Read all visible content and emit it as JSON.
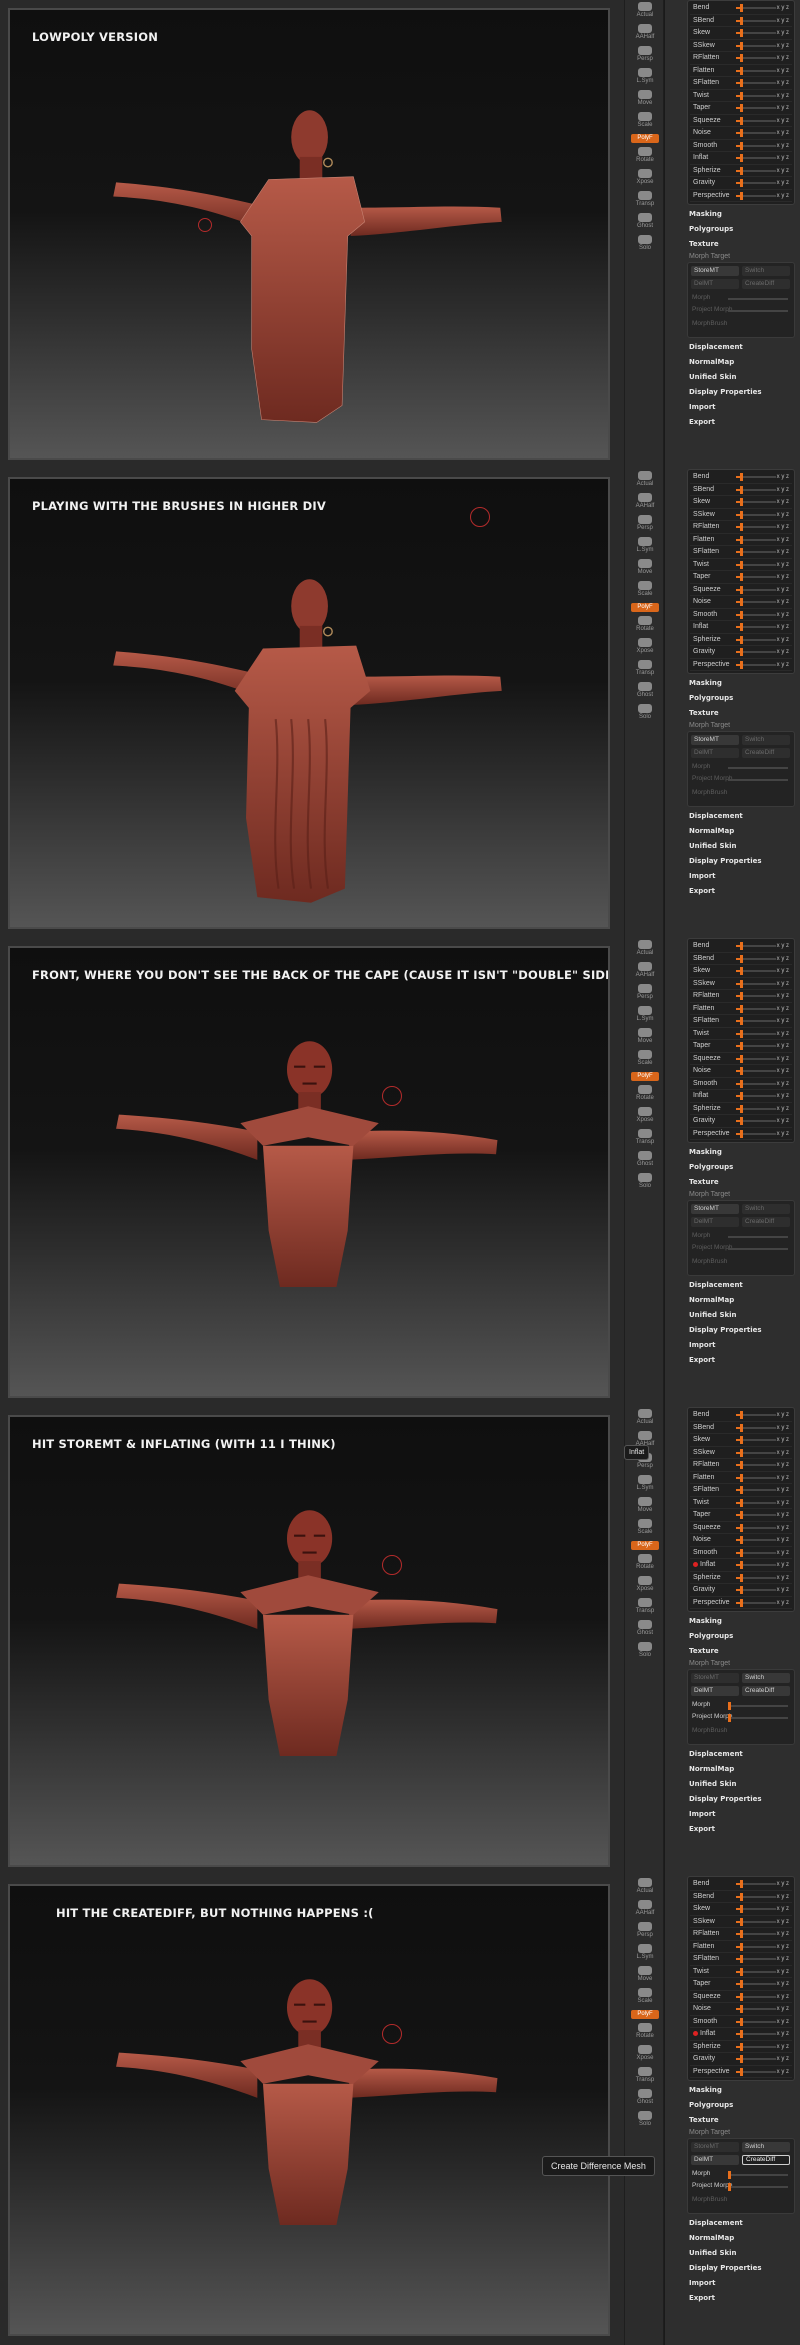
{
  "panels": [
    {
      "caption": "LOWPOLY VERSION",
      "pose": "back-low",
      "cursor": false,
      "inflat_marked": false,
      "morph": {
        "header": "Morph Target",
        "storemt": "StoreMT",
        "switch": "Switch",
        "delmt": "DelMT",
        "creatediff": "CreateDiff",
        "morph": "Morph",
        "project": "Project Morph",
        "morphbrush": "MorphBrush",
        "enabled": false
      },
      "tooltip": null
    },
    {
      "caption": "PLAYING WITH THE BRUSHES IN HIGHER DIV",
      "pose": "back-high",
      "cursor": true,
      "inflat_marked": false,
      "morph": {
        "header": "Morph Target",
        "storemt": "StoreMT",
        "switch": "Switch",
        "delmt": "DelMT",
        "creatediff": "CreateDiff",
        "morph": "Morph",
        "project": "Project Morph",
        "morphbrush": "MorphBrush",
        "enabled": false
      },
      "tooltip": null
    },
    {
      "caption": "FRONT, WHERE YOU DON'T SEE THE BACK OF THE CAPE (CAUSE IT ISN'T \"DOUBLE\" SIDED YET)",
      "pose": "front",
      "cursor": true,
      "inflat_marked": false,
      "morph": {
        "header": "Morph Target",
        "storemt": "StoreMT",
        "switch": "Switch",
        "delmt": "DelMT",
        "creatediff": "CreateDiff",
        "morph": "Morph",
        "project": "Project Morph",
        "morphbrush": "MorphBrush",
        "enabled": false
      },
      "tooltip": null
    },
    {
      "caption": "HIT STOREMT & INFLATING (WITH 11 I THINK)",
      "pose": "front",
      "cursor": true,
      "inflat_marked": true,
      "morph": {
        "header": "Morph Target",
        "storemt": "StoreMT",
        "switch": "Switch",
        "delmt": "DelMT",
        "creatediff": "CreateDiff",
        "morph": "Morph",
        "project": "Project Morph",
        "morphbrush": "MorphBrush",
        "enabled": true
      },
      "tooltip": {
        "text": "Inflat",
        "where": "toolstrip"
      }
    },
    {
      "caption": "HIT THE CREATEDIFF, BUT NOTHING HAPPENS :(",
      "pose": "front",
      "cursor": true,
      "inflat_marked": true,
      "morph": {
        "header": "Morph Target",
        "storemt": "StoreMT",
        "switch": "Switch",
        "delmt": "DelMT",
        "creatediff": "CreateDiff",
        "morph": "Morph",
        "project": "Project Morph",
        "morphbrush": "MorphBrush",
        "enabled": true
      },
      "tooltip": {
        "text": "Create Difference Mesh",
        "where": "morph"
      }
    }
  ],
  "toolstrip": [
    {
      "label": "Actual",
      "icon": "actual-icon"
    },
    {
      "label": "AAHalf",
      "icon": "aahalf-icon"
    },
    {
      "label": "Persp",
      "icon": "persp-icon"
    },
    {
      "label": "L.Sym",
      "icon": "lsym-icon"
    },
    {
      "label": "Move",
      "icon": "move-icon"
    },
    {
      "label": "Scale",
      "icon": "scale-icon"
    },
    {
      "label": "Rotate",
      "icon": "rotate-icon"
    },
    {
      "label": "Xpose",
      "icon": "xpose-icon"
    },
    {
      "label": "Transp",
      "icon": "transp-icon"
    },
    {
      "label": "Ghost",
      "icon": "ghost-icon"
    },
    {
      "label": "Solo",
      "icon": "solo-icon"
    }
  ],
  "toolstrip_orange": "PolyF",
  "deformation": [
    {
      "name": "Bend",
      "axes": "x y z"
    },
    {
      "name": "SBend",
      "axes": "x y z"
    },
    {
      "name": "Skew",
      "axes": "x y z"
    },
    {
      "name": "SSkew",
      "axes": "x y z"
    },
    {
      "name": "RFlatten",
      "axes": "x y z"
    },
    {
      "name": "Flatten",
      "axes": "x y z"
    },
    {
      "name": "SFlatten",
      "axes": "x y z"
    },
    {
      "name": "Twist",
      "axes": "x y z"
    },
    {
      "name": "Taper",
      "axes": "x y z"
    },
    {
      "name": "Squeeze",
      "axes": "x y z"
    },
    {
      "name": "Noise",
      "axes": "x y z"
    },
    {
      "name": "Smooth",
      "axes": "x y z"
    },
    {
      "name": "Inflat",
      "axes": "x y z"
    },
    {
      "name": "Spherize",
      "axes": "x y z"
    },
    {
      "name": "Gravity",
      "axes": "x y z"
    },
    {
      "name": "Perspective",
      "axes": "x y z"
    }
  ],
  "menu_top": [
    "Masking",
    "Polygroups",
    "Texture"
  ],
  "menu_bottom": [
    "Displacement",
    "NormalMap",
    "Unified Skin",
    "Display Properties",
    "Import",
    "Export"
  ],
  "colors": {
    "skin": "#a8483a",
    "skin_dark": "#5a1f18",
    "accent": "#e86f1c",
    "cursor": "#b32b2b"
  }
}
